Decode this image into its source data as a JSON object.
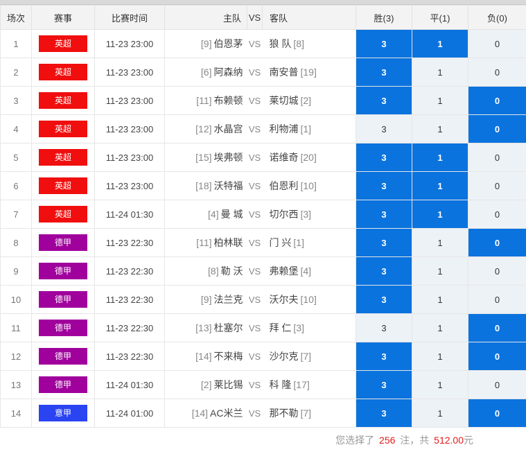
{
  "headers": {
    "index": "场次",
    "league": "赛事",
    "time": "比赛时间",
    "home": "主队",
    "vs": "VS",
    "away": "客队",
    "win": "胜(3)",
    "draw": "平(1)",
    "lose": "负(0)"
  },
  "colors": {
    "epl": "#f00e0e",
    "bundesliga": "#a0009c",
    "serie_a": "#2a44f2",
    "selected": "#0a73de",
    "unselected": "#edf2f7"
  },
  "rows": [
    {
      "idx": "1",
      "league": "英超",
      "league_color": "#f00e0e",
      "time": "11-23 23:00",
      "home_rank": "[9]",
      "home": "伯恩茅",
      "vs": "VS",
      "away": "狼 队",
      "away_rank": "[8]",
      "win": "3",
      "draw": "1",
      "lose": "0",
      "win_sel": true,
      "draw_sel": true,
      "lose_sel": false
    },
    {
      "idx": "2",
      "league": "英超",
      "league_color": "#f00e0e",
      "time": "11-23 23:00",
      "home_rank": "[6]",
      "home": "阿森纳",
      "vs": "VS",
      "away": "南安普",
      "away_rank": "[19]",
      "win": "3",
      "draw": "1",
      "lose": "0",
      "win_sel": true,
      "draw_sel": false,
      "lose_sel": false
    },
    {
      "idx": "3",
      "league": "英超",
      "league_color": "#f00e0e",
      "time": "11-23 23:00",
      "home_rank": "[11]",
      "home": "布赖顿",
      "vs": "VS",
      "away": "莱切城",
      "away_rank": "[2]",
      "win": "3",
      "draw": "1",
      "lose": "0",
      "win_sel": true,
      "draw_sel": false,
      "lose_sel": true
    },
    {
      "idx": "4",
      "league": "英超",
      "league_color": "#f00e0e",
      "time": "11-23 23:00",
      "home_rank": "[12]",
      "home": "水晶宫",
      "vs": "VS",
      "away": "利物浦",
      "away_rank": "[1]",
      "win": "3",
      "draw": "1",
      "lose": "0",
      "win_sel": false,
      "draw_sel": false,
      "lose_sel": true
    },
    {
      "idx": "5",
      "league": "英超",
      "league_color": "#f00e0e",
      "time": "11-23 23:00",
      "home_rank": "[15]",
      "home": "埃弗顿",
      "vs": "VS",
      "away": "诺维奇",
      "away_rank": "[20]",
      "win": "3",
      "draw": "1",
      "lose": "0",
      "win_sel": true,
      "draw_sel": true,
      "lose_sel": false
    },
    {
      "idx": "6",
      "league": "英超",
      "league_color": "#f00e0e",
      "time": "11-23 23:00",
      "home_rank": "[18]",
      "home": "沃特福",
      "vs": "VS",
      "away": "伯恩利",
      "away_rank": "[10]",
      "win": "3",
      "draw": "1",
      "lose": "0",
      "win_sel": true,
      "draw_sel": true,
      "lose_sel": false
    },
    {
      "idx": "7",
      "league": "英超",
      "league_color": "#f00e0e",
      "time": "11-24 01:30",
      "home_rank": "[4]",
      "home": "曼 城",
      "vs": "VS",
      "away": "切尔西",
      "away_rank": "[3]",
      "win": "3",
      "draw": "1",
      "lose": "0",
      "win_sel": true,
      "draw_sel": true,
      "lose_sel": false
    },
    {
      "idx": "8",
      "league": "德甲",
      "league_color": "#a0009c",
      "time": "11-23 22:30",
      "home_rank": "[11]",
      "home": "柏林联",
      "vs": "VS",
      "away": "门 兴",
      "away_rank": "[1]",
      "win": "3",
      "draw": "1",
      "lose": "0",
      "win_sel": true,
      "draw_sel": false,
      "lose_sel": true
    },
    {
      "idx": "9",
      "league": "德甲",
      "league_color": "#a0009c",
      "time": "11-23 22:30",
      "home_rank": "[8]",
      "home": "勒 沃",
      "vs": "VS",
      "away": "弗赖堡",
      "away_rank": "[4]",
      "win": "3",
      "draw": "1",
      "lose": "0",
      "win_sel": true,
      "draw_sel": false,
      "lose_sel": false
    },
    {
      "idx": "10",
      "league": "德甲",
      "league_color": "#a0009c",
      "time": "11-23 22:30",
      "home_rank": "[9]",
      "home": "法兰克",
      "vs": "VS",
      "away": "沃尔夫",
      "away_rank": "[10]",
      "win": "3",
      "draw": "1",
      "lose": "0",
      "win_sel": true,
      "draw_sel": false,
      "lose_sel": false
    },
    {
      "idx": "11",
      "league": "德甲",
      "league_color": "#a0009c",
      "time": "11-23 22:30",
      "home_rank": "[13]",
      "home": "杜塞尔",
      "vs": "VS",
      "away": "拜 仁",
      "away_rank": "[3]",
      "win": "3",
      "draw": "1",
      "lose": "0",
      "win_sel": false,
      "draw_sel": false,
      "lose_sel": true
    },
    {
      "idx": "12",
      "league": "德甲",
      "league_color": "#a0009c",
      "time": "11-23 22:30",
      "home_rank": "[14]",
      "home": "不来梅",
      "vs": "VS",
      "away": "沙尔克",
      "away_rank": "[7]",
      "win": "3",
      "draw": "1",
      "lose": "0",
      "win_sel": true,
      "draw_sel": false,
      "lose_sel": true
    },
    {
      "idx": "13",
      "league": "德甲",
      "league_color": "#a0009c",
      "time": "11-24 01:30",
      "home_rank": "[2]",
      "home": "莱比锡",
      "vs": "VS",
      "away": "科 隆",
      "away_rank": "[17]",
      "win": "3",
      "draw": "1",
      "lose": "0",
      "win_sel": true,
      "draw_sel": false,
      "lose_sel": false
    },
    {
      "idx": "14",
      "league": "意甲",
      "league_color": "#2a44f2",
      "time": "11-24 01:00",
      "home_rank": "[14]",
      "home": "AC米兰",
      "vs": "VS",
      "away": "那不勒",
      "away_rank": "[7]",
      "win": "3",
      "draw": "1",
      "lose": "0",
      "win_sel": true,
      "draw_sel": false,
      "lose_sel": true
    }
  ],
  "footer": {
    "prefix": "您选择了",
    "count": "256",
    "mid": "注，共",
    "amount": "512.00",
    "suffix": "元"
  }
}
